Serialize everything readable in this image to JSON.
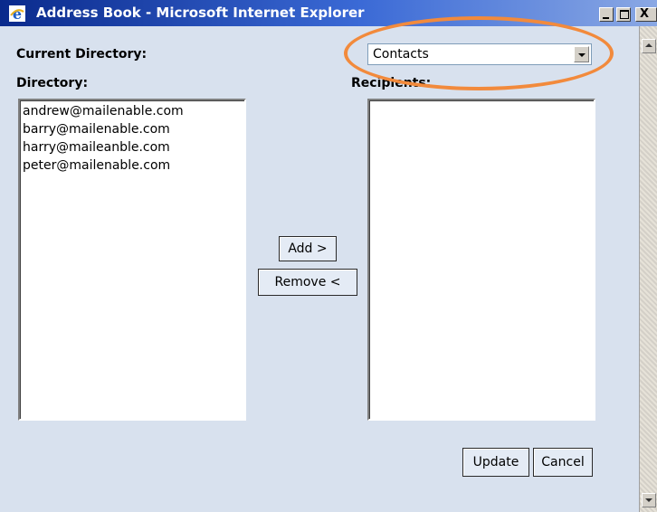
{
  "window": {
    "title": "Address Book - Microsoft Internet Explorer",
    "icon": "ie-icon",
    "close_glyph": "X"
  },
  "form": {
    "current_directory_label": "Current Directory:",
    "directory_label": "Directory:",
    "recipients_label": "Recipients:",
    "directory_select": {
      "value": "Contacts"
    },
    "directory_items": [
      "andrew@mailenable.com",
      "barry@mailenable.com",
      "harry@maileanble.com",
      "peter@mailenable.com"
    ],
    "recipients_items": []
  },
  "buttons": {
    "add": "Add >",
    "remove": "Remove <",
    "update": "Update",
    "cancel": "Cancel"
  },
  "colors": {
    "highlight": "#f28a3c",
    "background": "#d8e1ee",
    "titlebar": "#0a2a8c"
  }
}
